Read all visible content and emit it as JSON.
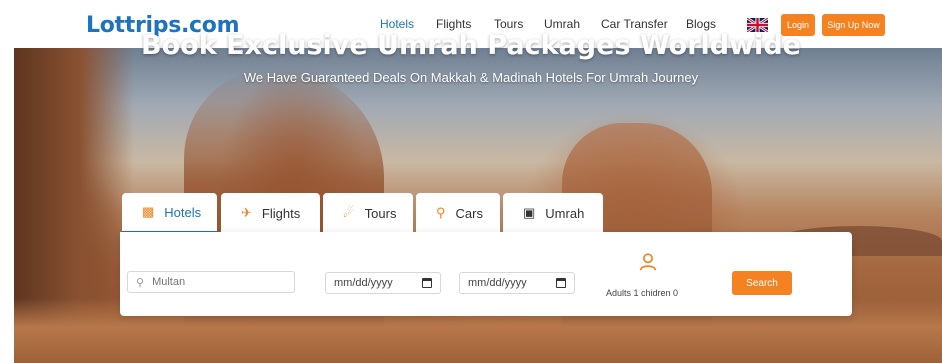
{
  "header": {
    "logo": "Lottrips.com",
    "nav": {
      "hotels": "Hotels",
      "flights": "Flights",
      "tours": "Tours",
      "umrah": "Umrah",
      "car_transfer": "Car Transfer",
      "blogs": "Blogs"
    },
    "login_label": "Login",
    "signup_label": "Sign Up Now",
    "active_nav": "Hotels",
    "accent_color": "#1e73be",
    "button_color": "#f58220"
  },
  "hero": {
    "title": "Book Exclusive Umrah Packages Worldwide",
    "subtitle": "We Have Guaranteed Deals On Makkah & Madinah Hotels For Umrah Journey"
  },
  "tabs": [
    {
      "label": "Hotels",
      "icon": "hotel-icon",
      "active": true
    },
    {
      "label": "Flights",
      "icon": "plane-icon",
      "active": false
    },
    {
      "label": "Tours",
      "icon": "walker-icon",
      "active": false
    },
    {
      "label": "Cars",
      "icon": "car-icon",
      "active": false
    },
    {
      "label": "Umrah",
      "icon": "kaaba-icon",
      "active": false
    }
  ],
  "search": {
    "city_placeholder": "Multan",
    "checkin_placeholder": "mm/dd/yyyy",
    "checkout_placeholder": "mm/dd/yyyy",
    "guests_text": "Adults 1 chidren 0",
    "search_label": "Search"
  }
}
